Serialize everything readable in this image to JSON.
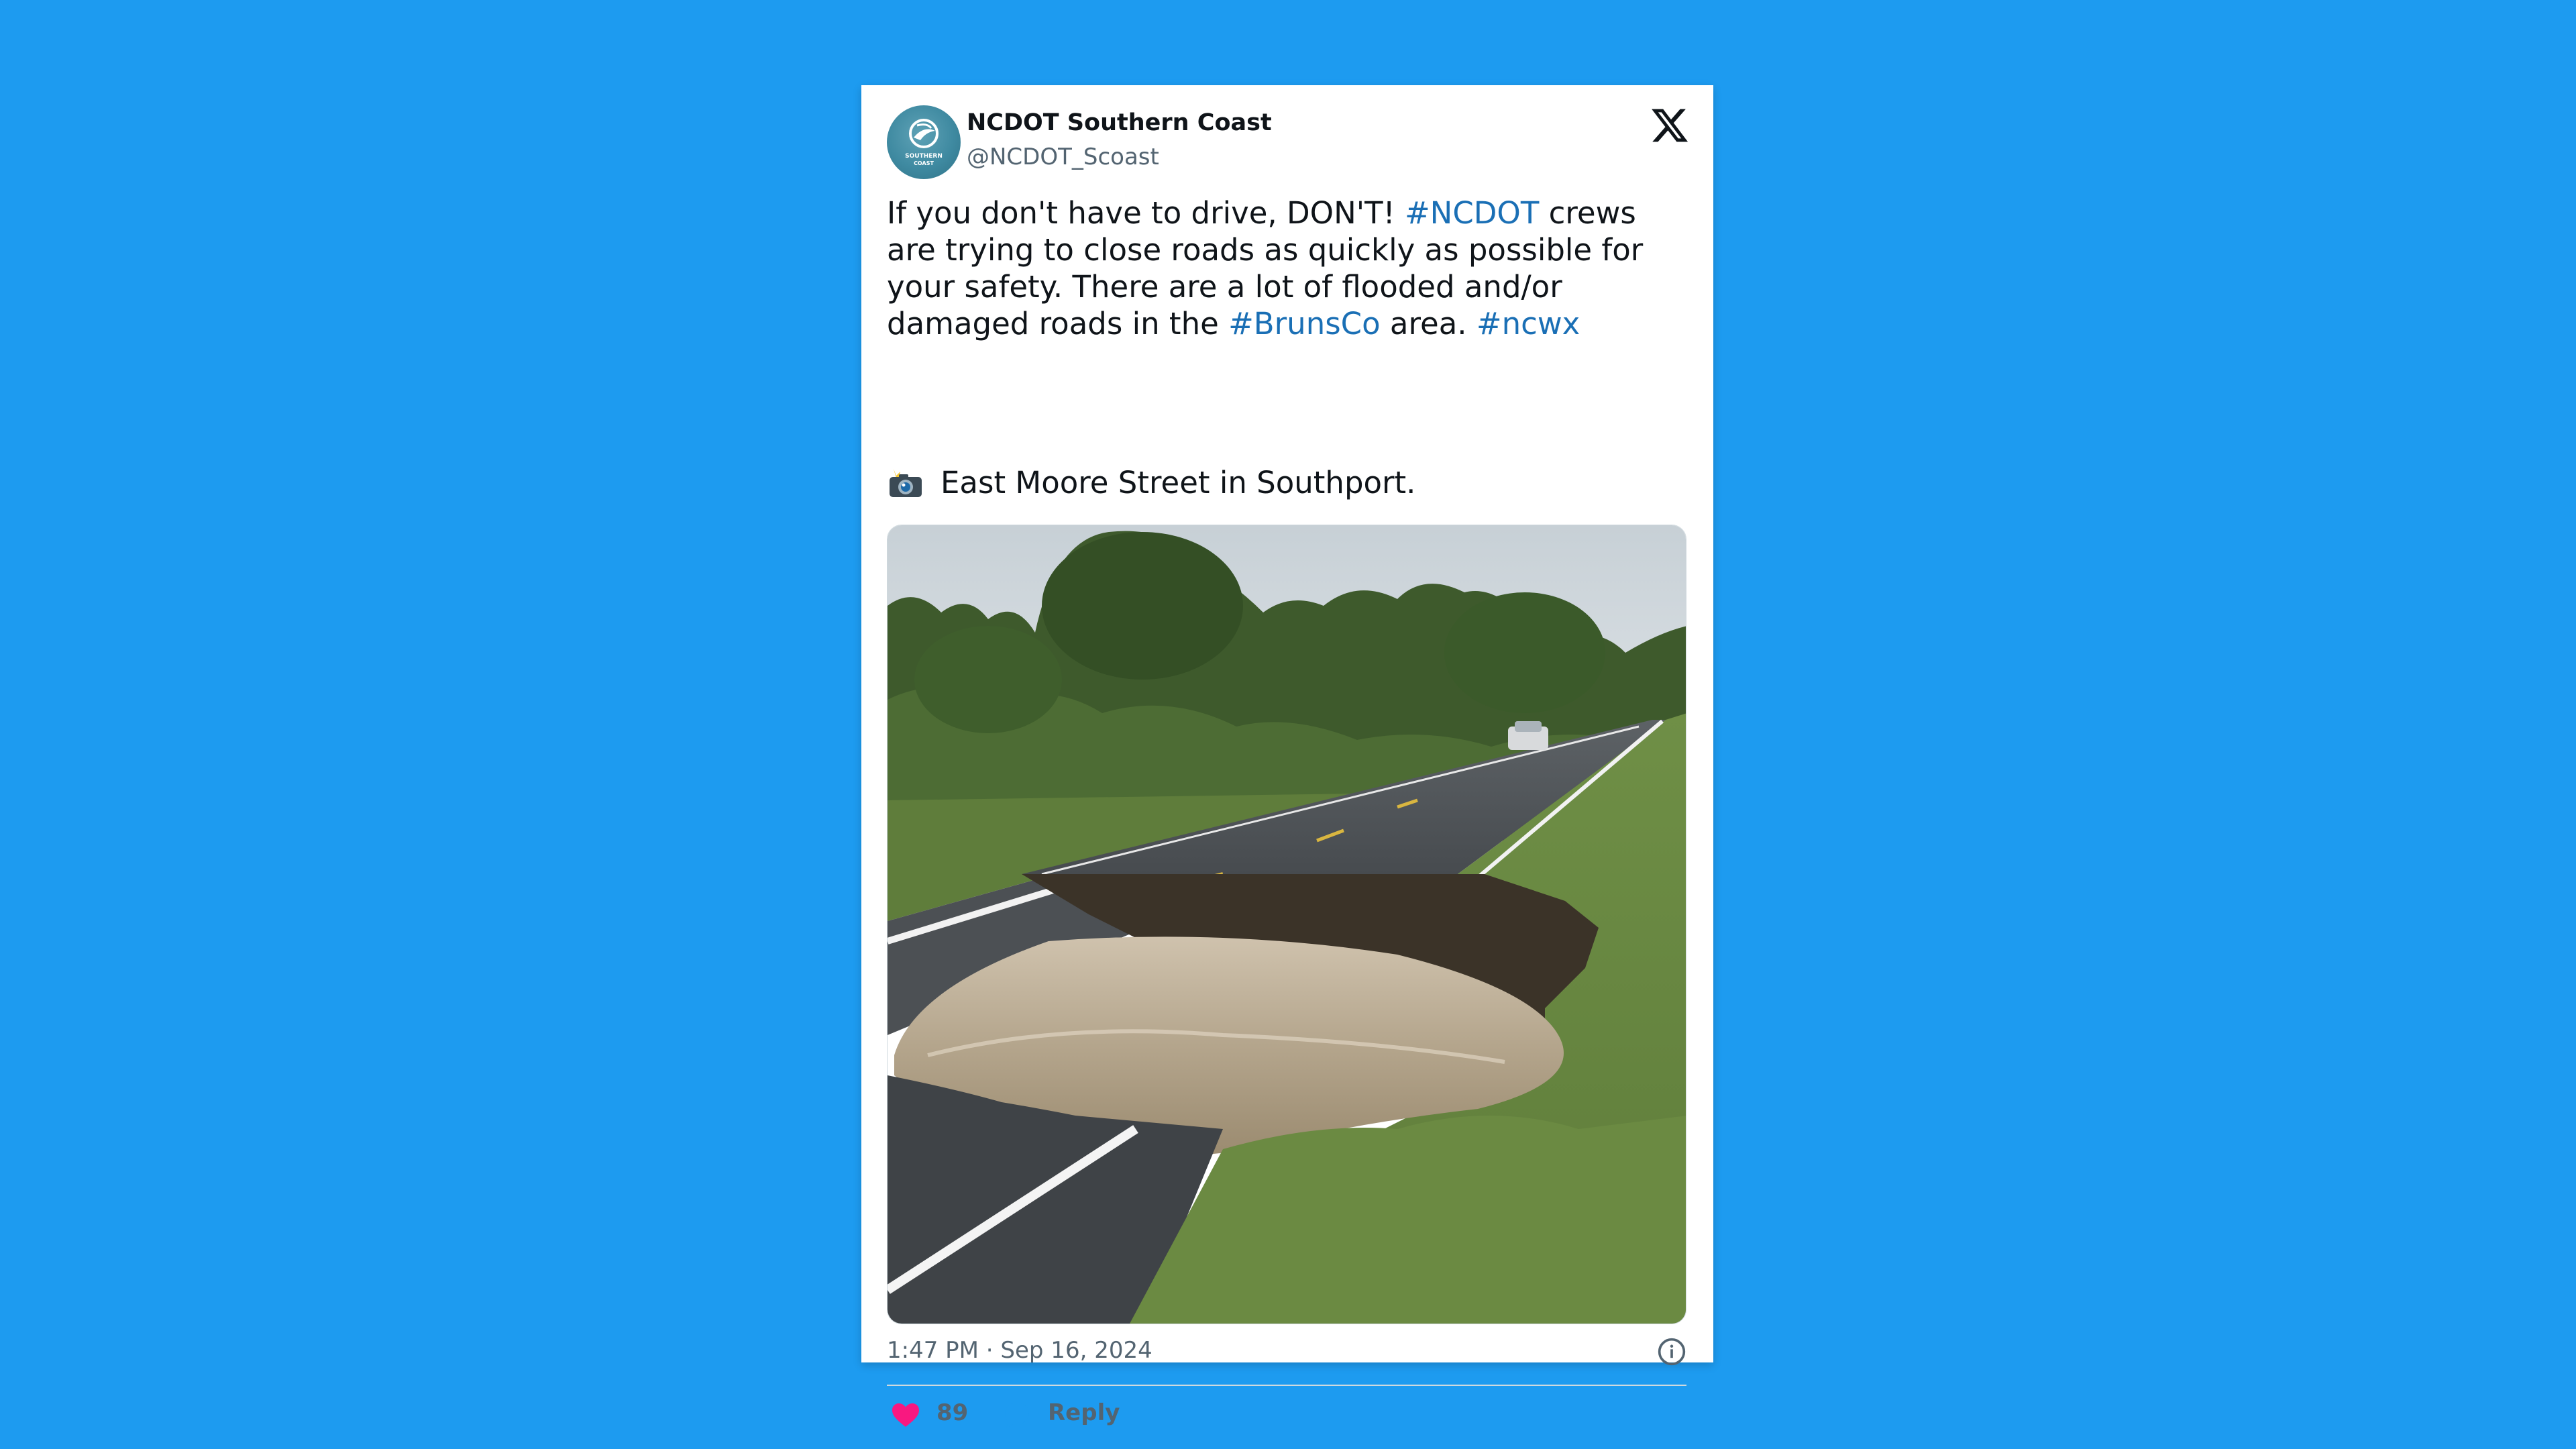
{
  "tweet": {
    "author": {
      "display_name": "NCDOT Southern Coast",
      "handle": "@NCDOT_Scoast",
      "avatar_text_line1": "SOUTHERN",
      "avatar_text_line2": "COAST"
    },
    "text_parts": [
      {
        "text": "If you don't have to drive, DON'T! ",
        "hashtag": false
      },
      {
        "text": "#NCDOT",
        "hashtag": true
      },
      {
        "text": " crews are trying to close roads as quickly as possible for your safety. There are a lot of flooded and/or damaged roads in the ",
        "hashtag": false
      },
      {
        "text": "#BrunsCo",
        "hashtag": true
      },
      {
        "text": " area. ",
        "hashtag": false
      },
      {
        "text": "#ncwx",
        "hashtag": true
      }
    ],
    "caption": "East Moore Street in Southport.",
    "caption_icon": "camera-flash-icon",
    "timestamp": "1:47 PM · Sep 16, 2024",
    "likes": "89",
    "reply_label": "Reply"
  },
  "colors": {
    "background": "#1d9bf0",
    "hashtag": "#1a6fb5",
    "like": "#f91880",
    "reply": "#1d9bf0",
    "secondary_text": "#536471"
  },
  "icons": [
    "x-logo-icon",
    "info-icon",
    "heart-icon",
    "speech-bubble-icon",
    "camera-flash-icon"
  ]
}
